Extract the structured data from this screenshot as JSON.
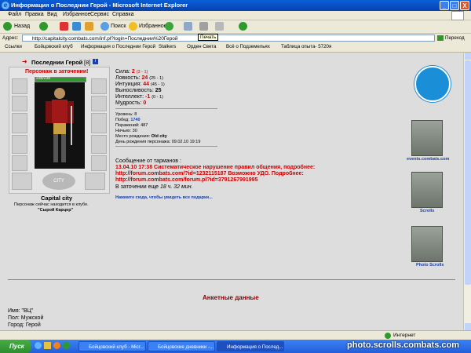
{
  "window": {
    "title": "Информация о Последнии Герой - Microsoft Internet Explorer",
    "minimize": "_",
    "maximize": "□",
    "close": "X"
  },
  "menu": [
    "Файл",
    "Правка",
    "Вид",
    "Избранное",
    "Сервис",
    "Справка"
  ],
  "toolbar": {
    "back": "Назад",
    "search": "Поиск",
    "favorites": "Избранное",
    "tooltip": "Печать"
  },
  "address": {
    "label": "Адрес:",
    "url": "http://capitalcity.combats.com/inf.pl?login=Последнии%20Герой",
    "go": "Переход"
  },
  "links": {
    "label": "Ссылки",
    "items": [
      "Бойцовский клуб",
      "Информация о Последнии Герой",
      "Stalkers",
      "Орден Света",
      "Всё о Подземельях",
      "Таблица опыта- 5720я"
    ]
  },
  "profile": {
    "name": "Последнии Герой",
    "level": "[8]",
    "info_icon": "i",
    "jail_status": "Персонаж в заточении!",
    "hp": "238/238",
    "city": "Capital city",
    "club_text": "Персонаж сейчас находится в клубе.",
    "room": "\"Сырой Карцер\"",
    "city_emblem": "CITY"
  },
  "stats": {
    "strength": {
      "label": "Сила:",
      "value": "2",
      "extra": "(3 - 1)"
    },
    "agility": {
      "label": "Ловкость:",
      "value": "24",
      "extra": "(25 - 1)"
    },
    "intuition": {
      "label": "Интуиция:",
      "value": "44",
      "extra": "(45 - 1)"
    },
    "endurance": {
      "label": "Выносливость:",
      "value": "25",
      "extra": ""
    },
    "intellect": {
      "label": "Интеллект:",
      "value": "-1",
      "extra": "(0 - 1)"
    },
    "wisdom": {
      "label": "Мудрость:",
      "value": "0",
      "extra": ""
    }
  },
  "records": {
    "level": "Уровень: 8",
    "wins_label": "Побед:",
    "wins": "1740",
    "losses": "Поражений: 487",
    "draws": "Ничьих: 30",
    "birthplace_label": "Место рождения:",
    "birthplace": "Old city",
    "birthday": "День рождения персонажа: 09.02.10 19:19"
  },
  "message": {
    "header": "Сообщение от тарманов :",
    "line1": "13.04.10 17:38 Систематическое нарушение правил общения, подробнее:",
    "line2": "http://forum.combats.com/?id=1232115187 Возможно УДО. Подробнее:",
    "line3": "http://forum.combats.com/forum.pl?id=3791267991995",
    "jail_prefix": "В заточении еще",
    "jail_time": "18 ч. 32 мин."
  },
  "gifts_link": "Нажмите сюда, чтобы увидеть все подарки...",
  "sidebar": {
    "events_caption": "events.combats.com",
    "scrolls_caption": "Scrolls",
    "photo_caption": "Photo Scrolls"
  },
  "anketa": {
    "header": "Анкетные данные",
    "name": "Имя: \"ВЦ\"",
    "gender": "Пол: Мужской",
    "city": "Город: Герой"
  },
  "status": {
    "zone": "Интернет"
  },
  "taskbar": {
    "start": "Пуск",
    "tasks": [
      "Бойцовский клуб - Micr...",
      "Бойцовские дневники -...",
      "Информация о Послед..."
    ],
    "watermark": "photo.scrolls.combats.com"
  },
  "colors": {
    "title_blue": "#0a5fd6",
    "alert_red": "#cc0000",
    "hp_green": "#2e9a2e",
    "link_blue": "#1a3fa8"
  }
}
